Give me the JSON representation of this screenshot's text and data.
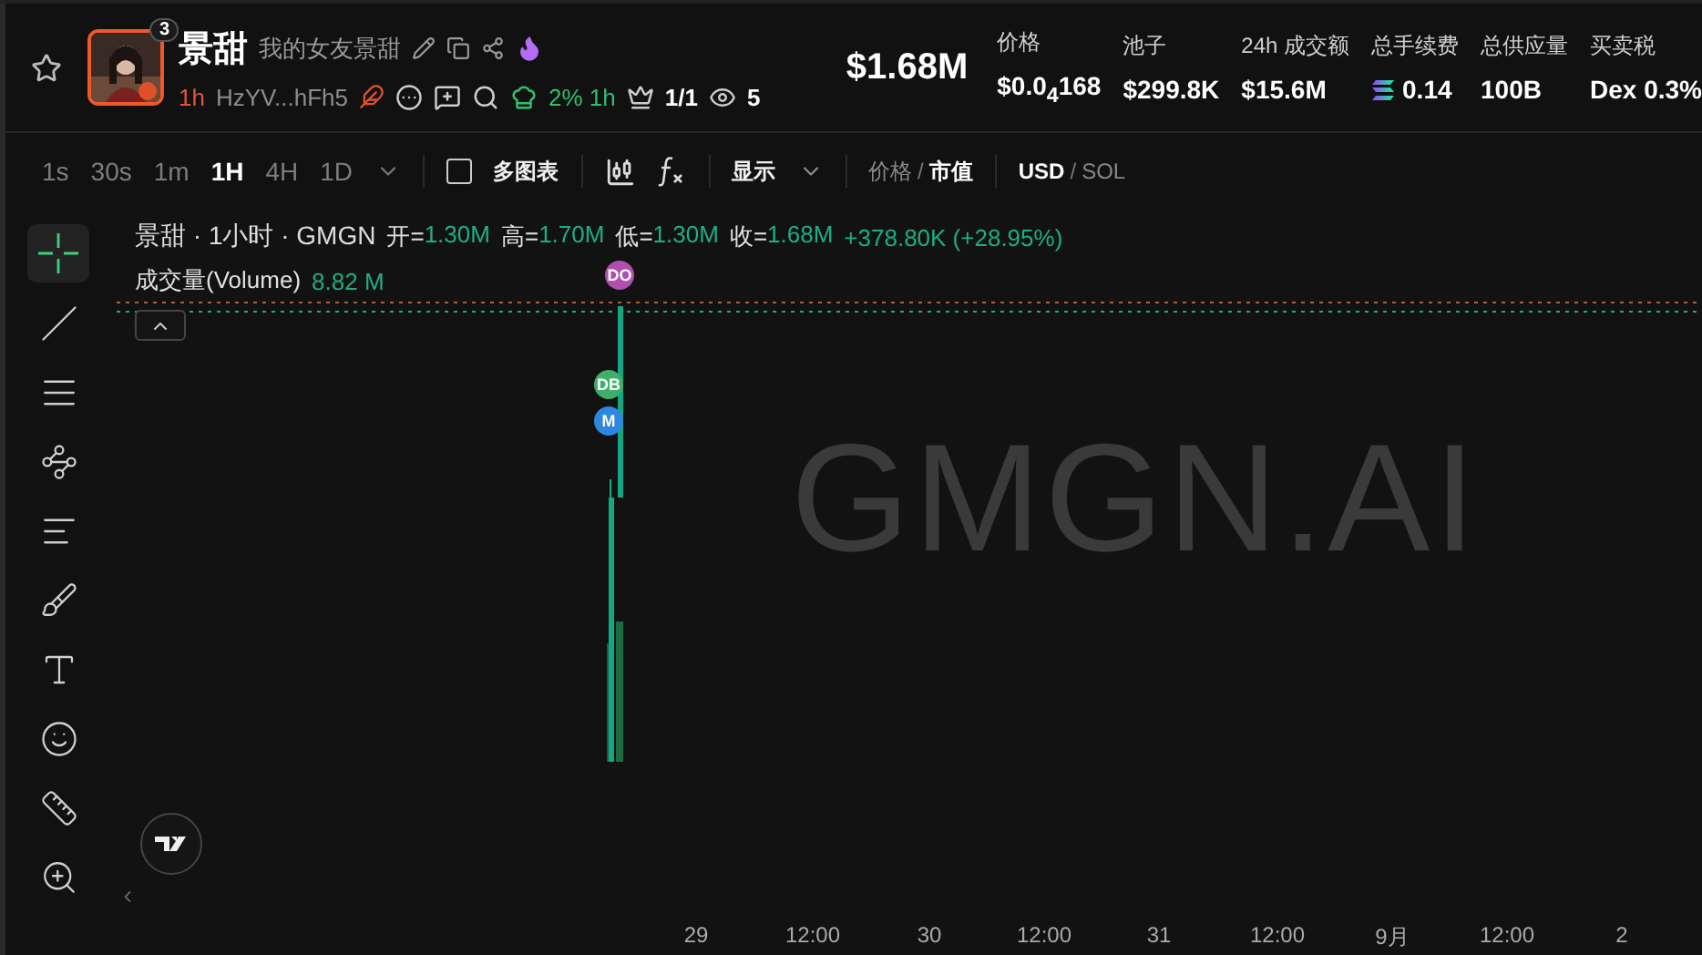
{
  "token": {
    "avatar": {
      "kind": "picture",
      "badge": "3"
    },
    "name": "景甜",
    "subtitle": "我的女友景甜",
    "age": "1h",
    "address": "HzYV...hFh5",
    "dev_stat": "2% 1h",
    "holders": "1/1",
    "watchers": "5",
    "market_cap": "$1.68M"
  },
  "stats": [
    {
      "label": "价格",
      "value": "$0.0$_{4}$168",
      "kind": "plain"
    },
    {
      "label": "池子",
      "value": "$299.8K",
      "kind": "plain"
    },
    {
      "label": "24h 成交额",
      "value": "$15.6M",
      "kind": "plain"
    },
    {
      "label": "总手续费",
      "value": "0.14",
      "kind": "sol"
    },
    {
      "label": "总供应量",
      "value": "100B",
      "kind": "plain"
    },
    {
      "label": "买卖税",
      "value": "Dex 0.3%",
      "kind": "plain"
    }
  ],
  "toolbar": {
    "intervals": [
      {
        "label": "1s",
        "selected": false
      },
      {
        "label": "30s",
        "selected": false
      },
      {
        "label": "1m",
        "selected": false
      },
      {
        "label": "1H",
        "selected": true
      },
      {
        "label": "4H",
        "selected": false
      },
      {
        "label": "1D",
        "selected": false
      }
    ],
    "multi_chart": {
      "label": "多图表",
      "checked": false
    },
    "display": "显示",
    "separator": "/",
    "price_mode": [
      {
        "label": "价格",
        "selected": false
      },
      {
        "label": "市值",
        "selected": true
      }
    ],
    "currency": [
      {
        "label": "USD",
        "selected": true
      },
      {
        "label": "SOL",
        "selected": false
      }
    ]
  },
  "tools": [
    {
      "kind": "crosshair",
      "selected": true
    },
    {
      "kind": "line",
      "selected": false
    },
    {
      "kind": "hlines",
      "selected": false
    },
    {
      "kind": "nodes",
      "selected": false
    },
    {
      "kind": "fib",
      "selected": false
    },
    {
      "kind": "brush",
      "selected": false
    },
    {
      "kind": "text",
      "selected": false
    },
    {
      "kind": "emoji",
      "selected": false
    },
    {
      "kind": "ruler",
      "selected": false
    },
    {
      "kind": "zoom",
      "selected": false
    }
  ],
  "chart": {
    "title": "景甜 · 1小时 · GMGN",
    "ohlc": [
      {
        "label": "开=",
        "value": "1.30M"
      },
      {
        "label": "高=",
        "value": "1.70M"
      },
      {
        "label": "低=",
        "value": "1.30M"
      },
      {
        "label": "收=",
        "value": "1.68M"
      }
    ],
    "change": "+378.80K (+28.95%)",
    "volume_label": "成交量(Volume)",
    "volume_value": "8.82 M",
    "watermark": "GMGN.AI",
    "markers": [
      {
        "label": "DO",
        "color": "#b04fb0"
      },
      {
        "label": "DB",
        "color": "#3fae6a"
      },
      {
        "label": "M",
        "color": "#2f86e0"
      }
    ],
    "x_labels": [
      "29",
      "12:00",
      "30",
      "12:00",
      "31",
      "12:00",
      "9月",
      "12:00",
      "2"
    ]
  }
}
